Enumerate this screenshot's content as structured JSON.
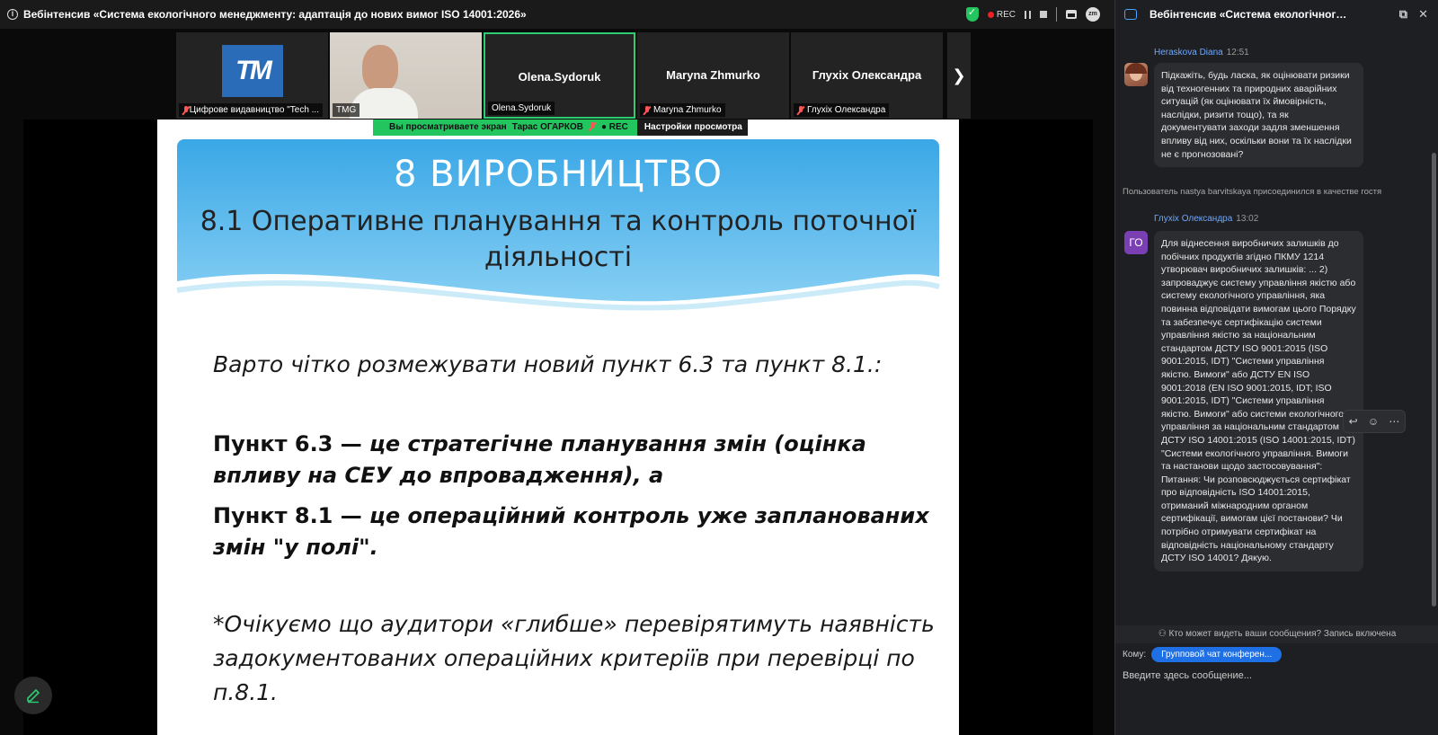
{
  "topbar": {
    "title": "Вебінтенсив «Система екологічного менеджменту: адаптація до нових вимог ISO 14001:2026»",
    "rec_label": "REC"
  },
  "tiles": [
    {
      "label": "Цифрове видавництво \"Tech ...",
      "type": "logo",
      "logo_text": "ТМ",
      "muted": true
    },
    {
      "label": "TMG",
      "type": "photo",
      "muted": false
    },
    {
      "name": "Olena.Sydoruk",
      "label": "Olena.Sydoruk",
      "type": "name",
      "active": true,
      "muted": false
    },
    {
      "name": "Maryna Zhmurko",
      "label": "Maryna Zhmurko",
      "type": "name",
      "muted": true
    },
    {
      "name": "Глухіх Олександра",
      "label": "Глухіх Олександра",
      "type": "name",
      "muted": true
    }
  ],
  "share_banner": {
    "viewing": "Вы просматриваете экран",
    "presenter": "Тарас ОГАРКОВ",
    "rec": "REC",
    "settings": "Настройки просмотра"
  },
  "slide": {
    "title": "8 ВИРОБНИЦТВО",
    "subtitle": "8.1 Оперативне планування та контроль поточної діяльності",
    "p1": "Варто чітко розмежувати новий пункт 6.3 та пункт 8.1.:",
    "p2_a": "Пункт 6.3 — ",
    "p2_b": "це стратегічне планування змін (оцінка впливу на СЕУ до впровадження), а",
    "p3_a": "Пункт 8.1 — ",
    "p3_b": "це операційний контроль уже запланованих змін \"у полі\".",
    "p4": "*Очікуємо що аудитори «глибше» перевірятимуть наявність задокументованих операційних критеріїв при перевірці по п.8.1."
  },
  "chat": {
    "title": "Вебінтенсив «Система екологічного ...",
    "messages": [
      {
        "author": "Heraskova Diana",
        "time": "12:51",
        "text": "Підкажіть, будь ласка, як оцінювати ризики від техногенних та природних аварійних ситуацій (як оцінювати їх ймовірність, наслідки, ризити тощо), та як документувати заходи задля зменшення впливу від них, оскільки вони та їх наслідки не є прогнозовані?"
      },
      {
        "author": "Глухіх Олександра",
        "time": "13:02",
        "avatar": "ГО",
        "text": "Для віднесення виробничих залишків до побічних продуктів згідно ПКМУ 1214 утворювач виробничих залишків: ... 2) запроваджує систему управління якістю або систему екологічного управління, яка повинна відповідати вимогам цього Порядку та забезпечує сертифікацію системи управління якістю за національним стандартом ДСТУ ISO 9001:2015 (ISO 9001:2015, IDT) \"Системи управління якістю. Вимоги\" або ДСТУ EN ISO 9001:2018 (EN ISO 9001:2015, IDT; ISO 9001:2015, IDT) \"Системи управління якістю. Вимоги\" або системи екологічного управління за національним стандартом ДСТУ ISO 14001:2015 (ISO 14001:2015, IDT) \"Системи екологічного управління. Вимоги та настанови щодо застосовування\": Питання: Чи розповсюджується сертифікат про відповідність ISO 14001:2015, отриманий міжнародним органом сертифікації, вимогам цієї постанови? Чи потрібно отримувати сертифікат на відповідність національному стандарту ДСТУ ISO 14001?  Дякую."
      }
    ],
    "system_note": "Пользователь nastya barvitskaya присоединился в качестве гостя",
    "privacy": "Кто может видеть ваши сообщения? Запись включена",
    "to_label": "Кому:",
    "to_value": "Групповой чат конферен...",
    "input_placeholder": "Введите здесь сообщение..."
  }
}
